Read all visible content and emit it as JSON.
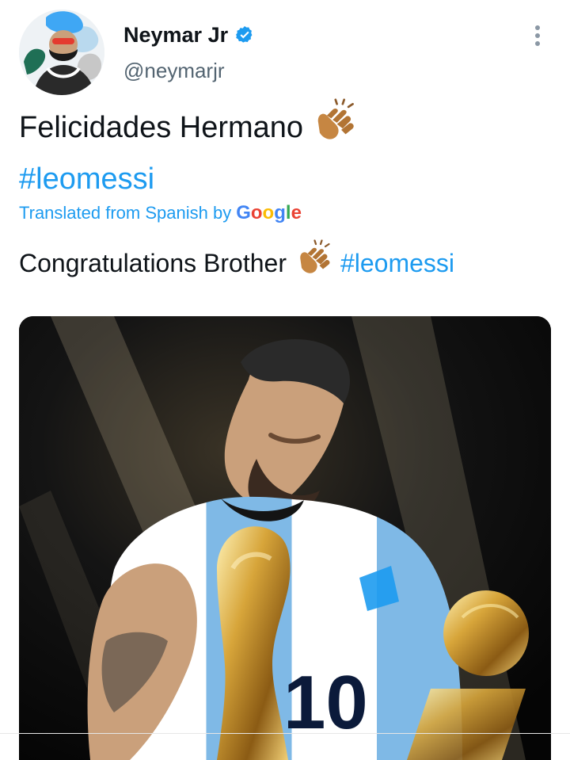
{
  "tweet": {
    "author_name": "Neymar Jr",
    "handle": "@neymarjr",
    "text_prefix": "Felicidades Hermano",
    "hashtag": "#leomessi",
    "translated_label": "Translated from Spanish by",
    "google_logo_text": "Google",
    "translation_prefix": "Congratulations Brother",
    "translation_hashtag": "#leomessi",
    "emoji": "clapping-hands"
  },
  "icons": {
    "verified": "verified-badge-icon",
    "more": "more-options-icon"
  },
  "colors": {
    "text": "#0f1419",
    "secondary_text": "#536471",
    "link": "#1d9bf0",
    "verified": "#1d9bf0",
    "clap_skin": "#C68642"
  }
}
